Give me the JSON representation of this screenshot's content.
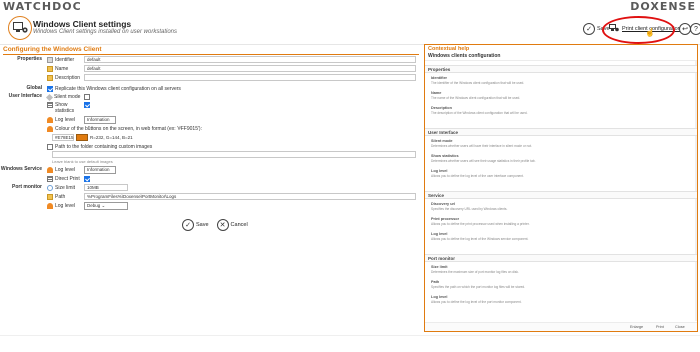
{
  "brand": {
    "left": "WATCHDOC",
    "right": "DOXENSE"
  },
  "header": {
    "title": "Windows Client settings",
    "subtitle": "Windows Client settings installed on user workstations",
    "save_label": "Save",
    "print_config_label": "Print client configuration",
    "accent": "#e07b10",
    "highlight_color": "#e01010"
  },
  "section": {
    "title": "Configuring the Windows Client"
  },
  "properties": {
    "group_label": "Properties",
    "identifier_label": "Identifier",
    "identifier_value": "default",
    "name_label": "Name",
    "name_value": "default",
    "description_label": "Description",
    "description_value": ""
  },
  "global": {
    "group_label": "Global",
    "replicate_label": "Replicate this Windows client configuration on all servers"
  },
  "ui": {
    "group_label": "User Interface",
    "silent_label": "Silent mode",
    "show_label": "Show",
    "statistics_label": "statistics",
    "log_level_label": "Log level",
    "log_level_value": "Information",
    "colour_label": "Colour of the buttons on the screen, in web format (ex: '#FF9015'):",
    "colour_value": "#E78E15",
    "rgb_text": "R=232, G=144, B=21",
    "path_label": "Path to the folder containing custom images",
    "path_hint": "Leave blank to use default images"
  },
  "service": {
    "group_label": "Windows Service",
    "log_level_label": "Log level",
    "log_level_value": "Information",
    "direct_print_label": "Direct Print"
  },
  "port_monitor": {
    "group_label": "Port monitor",
    "size_limit_label": "Size limit",
    "size_limit_value": "10MB",
    "path_label": "Path",
    "path_value": "%ProgramFiles%\\Doxense\\PortMonitor\\Logs",
    "log_level_label": "Log level",
    "log_level_value": "Debug"
  },
  "form_actions": {
    "save": "Save",
    "cancel": "Cancel"
  },
  "help": {
    "title": "Contextual help",
    "subtitle": "Windows clients configuration",
    "sections": [
      {
        "title": "Properties",
        "items": [
          {
            "t": "Identifier",
            "d": "The identifier of the Windows client configuration that will be used."
          },
          {
            "t": "Name",
            "d": "The name of the Windows client configuration that will be used."
          },
          {
            "t": "Description",
            "d": "The description of the Windows client configuration that will be used."
          }
        ]
      },
      {
        "title": "User Interface",
        "items": [
          {
            "t": "Silent mode",
            "d": "Determines whether users will have their interface in silent mode or not."
          },
          {
            "t": "Show statistics",
            "d": "Determines whether users will see their usage statistics in their profile tab."
          },
          {
            "t": "Log level",
            "d": "Allows you to define the log level of the user interface component."
          }
        ]
      },
      {
        "title": "Service",
        "items": [
          {
            "t": "Discovery url",
            "d": "Specifies the discovery URL used by Windows clients."
          },
          {
            "t": "Print processor",
            "d": "Allows you to define the print processor used when installing a printer."
          },
          {
            "t": "Log level",
            "d": "Allows you to define the log level of the Windows service component."
          }
        ]
      },
      {
        "title": "Port monitor",
        "items": [
          {
            "t": "Size limit",
            "d": "Determines the maximum size of port monitor log files on disk."
          },
          {
            "t": "Path",
            "d": "Specifies the path on which the port monitor log files will be stored."
          },
          {
            "t": "Log level",
            "d": "Allows you to define the log level of the port monitor component."
          }
        ]
      }
    ],
    "footer": {
      "enlarge": "Enlarge",
      "print": "Print",
      "close": "Close"
    }
  }
}
